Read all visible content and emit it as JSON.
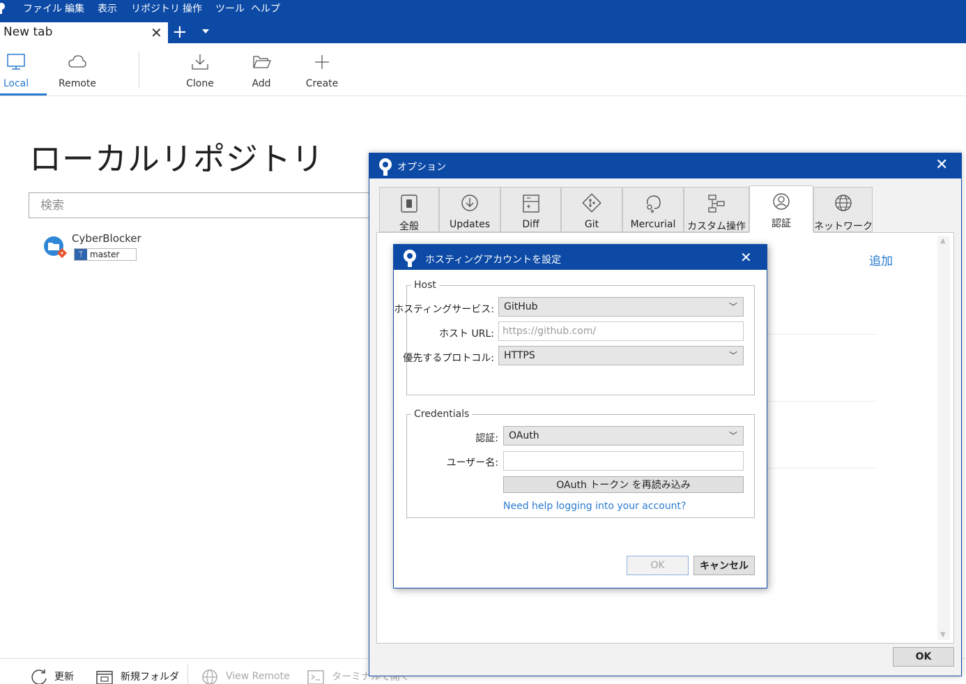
{
  "colors": {
    "accent": "#0c4aa6",
    "link": "#2a7ad1"
  },
  "menubar": {
    "items": [
      "ファイル",
      "編集",
      "表示",
      "リポジトリ",
      "操作",
      "ツール",
      "ヘルプ"
    ]
  },
  "tabs": {
    "active_label": "New tab",
    "close_glyph": "✕",
    "add_glyph": "+"
  },
  "toolbar": {
    "local": "Local",
    "remote": "Remote",
    "clone": "Clone",
    "add": "Add",
    "create": "Create"
  },
  "main": {
    "title": "ローカルリポジトリ",
    "search_placeholder": "検索",
    "repo": {
      "name": "CyberBlocker",
      "branch": "master"
    }
  },
  "bottombar": {
    "refresh": "更新",
    "new_folder": "新規フォルダ",
    "view_remote": "View Remote",
    "terminal": "ターミナルで開く"
  },
  "options": {
    "title": "オプション",
    "close_glyph": "✕",
    "tabs": [
      "全般",
      "Updates",
      "Diff",
      "Git",
      "Mercurial",
      "カスタム操作",
      "認証",
      "ネットワーク"
    ],
    "active_tab": "認証",
    "add_link": "追加",
    "ok": "OK"
  },
  "hosting_dialog": {
    "title": "ホスティングアカウントを設定",
    "close_glyph": "✕",
    "host_legend": "Host",
    "service_label": "ホスティングサービス:",
    "service_value": "GitHub",
    "url_label": "ホスト URL:",
    "url_placeholder": "https://github.com/",
    "protocol_label": "優先するプロトコル:",
    "protocol_value": "HTTPS",
    "credentials_legend": "Credentials",
    "auth_label": "認証:",
    "auth_value": "OAuth",
    "username_label": "ユーザー名:",
    "username_value": "",
    "reload_token": "OAuth トークン を再読み込み",
    "help_link": "Need help logging into your account?",
    "ok": "OK",
    "cancel": "キャンセル"
  }
}
